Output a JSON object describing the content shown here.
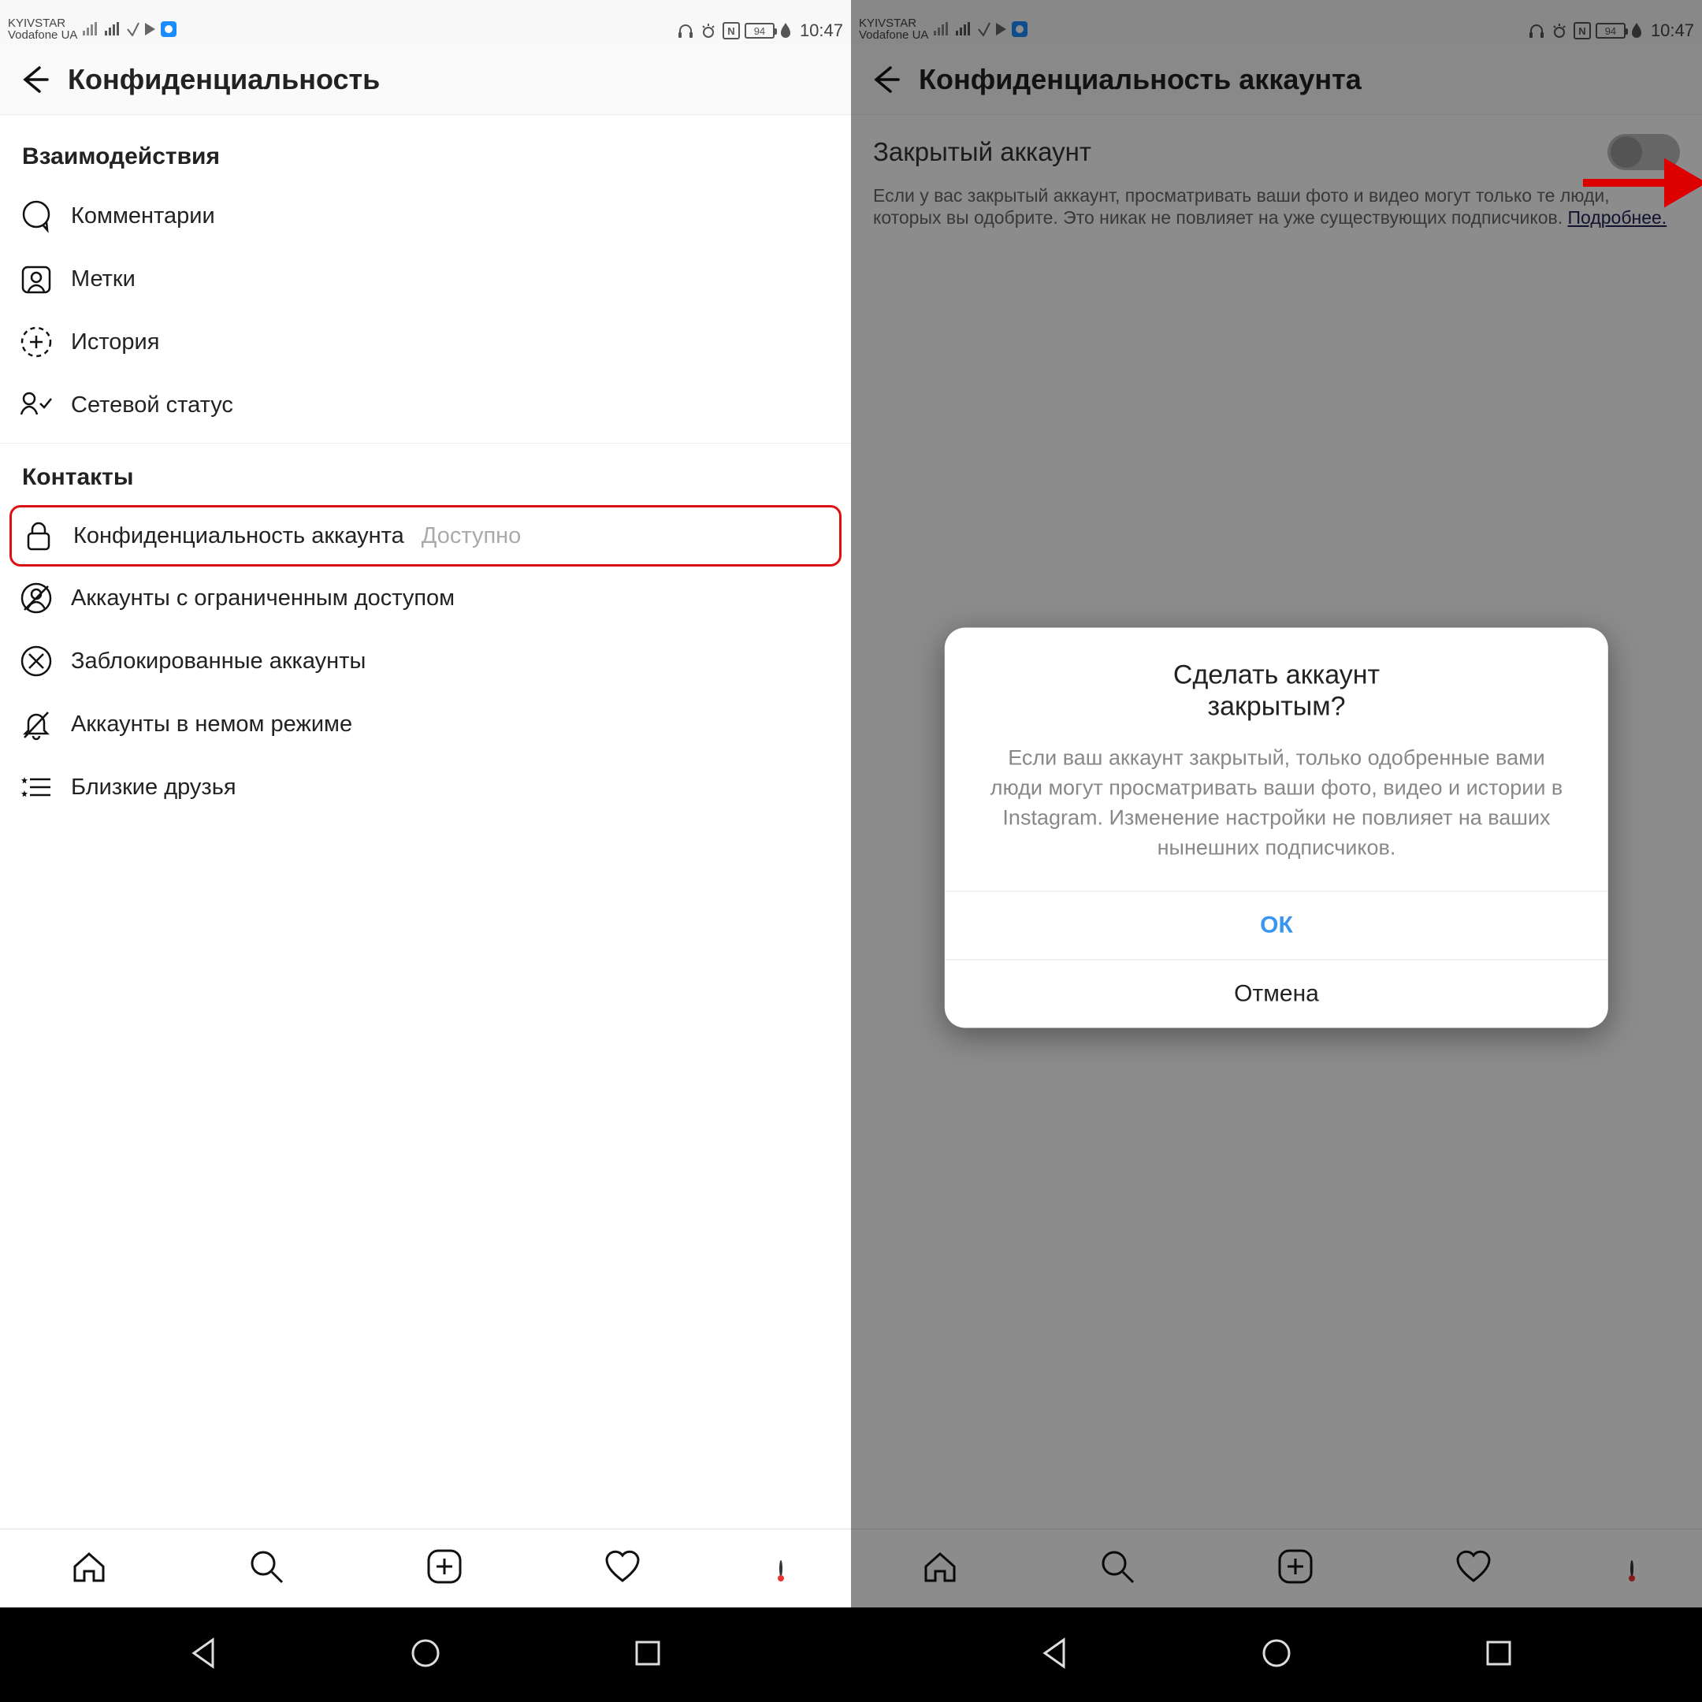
{
  "status": {
    "carrier1": "KYIVSTAR",
    "carrier2": "Vodafone UA",
    "battery": "94",
    "time": "10:47"
  },
  "left": {
    "header_title": "Конфиденциальность",
    "section_interactions": "Взаимодействия",
    "items_interactions": {
      "comments": "Комментарии",
      "tags": "Метки",
      "story": "История",
      "activity_status": "Сетевой статус"
    },
    "section_contacts": "Контакты",
    "items_contacts": {
      "account_privacy": "Конфиденциальность аккаунта",
      "account_privacy_suffix": "Доступно",
      "restricted": "Аккаунты с ограниченным доступом",
      "blocked": "Заблокированные аккаунты",
      "muted": "Аккаунты в немом режиме",
      "close_friends": "Близкие друзья"
    }
  },
  "right": {
    "header_title": "Конфиденциальность аккаунта",
    "private_account_label": "Закрытый аккаунт",
    "description": "Если у вас закрытый аккаунт, просматривать ваши фото и видео могут только те люди, которых вы одобрите. Это никак не повлияет на уже существующих подписчиков.",
    "learn_more": "Подробнее.",
    "dialog": {
      "title_line1": "Сделать аккаунт",
      "title_line2": "закрытым?",
      "body": "Если ваш аккаунт закрытый, только одобренные вами люди могут просматривать ваши фото, видео и истории в Instagram. Изменение настройки не повлияет на ваших нынешних подписчиков.",
      "ok": "ОК",
      "cancel": "Отмена"
    }
  }
}
